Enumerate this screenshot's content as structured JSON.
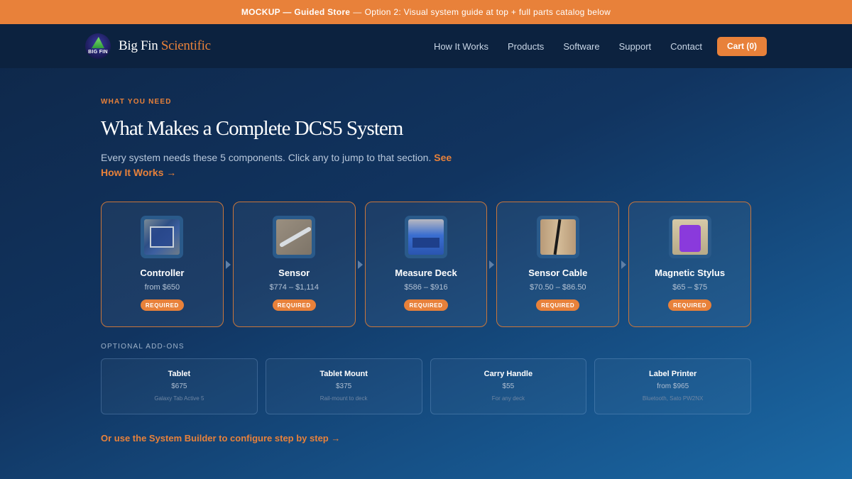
{
  "banner": {
    "strong": "MOCKUP — Guided Store",
    "rest": "Option 2: Visual system guide at top + full parts catalog below"
  },
  "nav": {
    "logo_badge": "BIG FIN",
    "brand_1": "Big Fin",
    "brand_2": "Scientific",
    "links": [
      "How It Works",
      "Products",
      "Software",
      "Support",
      "Contact"
    ],
    "cart": "Cart (0)"
  },
  "hero": {
    "eyebrow": "WHAT YOU NEED",
    "title": "What Makes a Complete DCS5 System",
    "lead": "Every system needs these 5 components. Click any to jump to that section.",
    "lead_link": "See How It Works →"
  },
  "components": [
    {
      "name": "Controller",
      "price": "from $650",
      "badge": "REQUIRED"
    },
    {
      "name": "Sensor",
      "price": "$774 – $1,114",
      "badge": "REQUIRED"
    },
    {
      "name": "Measure Deck",
      "price": "$586 – $916",
      "badge": "REQUIRED"
    },
    {
      "name": "Sensor Cable",
      "price": "$70.50 – $86.50",
      "badge": "REQUIRED"
    },
    {
      "name": "Magnetic Stylus",
      "price": "$65 – $75",
      "badge": "REQUIRED"
    }
  ],
  "addons_label": "OPTIONAL ADD-ONS",
  "addons": [
    {
      "name": "Tablet",
      "price": "$675",
      "note": "Galaxy Tab Active 5"
    },
    {
      "name": "Tablet Mount",
      "price": "$375",
      "note": "Rail-mount to deck"
    },
    {
      "name": "Carry Handle",
      "price": "$55",
      "note": "For any deck"
    },
    {
      "name": "Label Printer",
      "price": "from $965",
      "note": "Bluetooth, Sato PW2NX"
    }
  ],
  "builder_link": "Or use the System Builder to configure step by step →",
  "colors": {
    "accent": "#e8813a",
    "nav_bg": "#0c223f",
    "bg_start": "#0e2647",
    "bg_end": "#1b6aa6"
  }
}
